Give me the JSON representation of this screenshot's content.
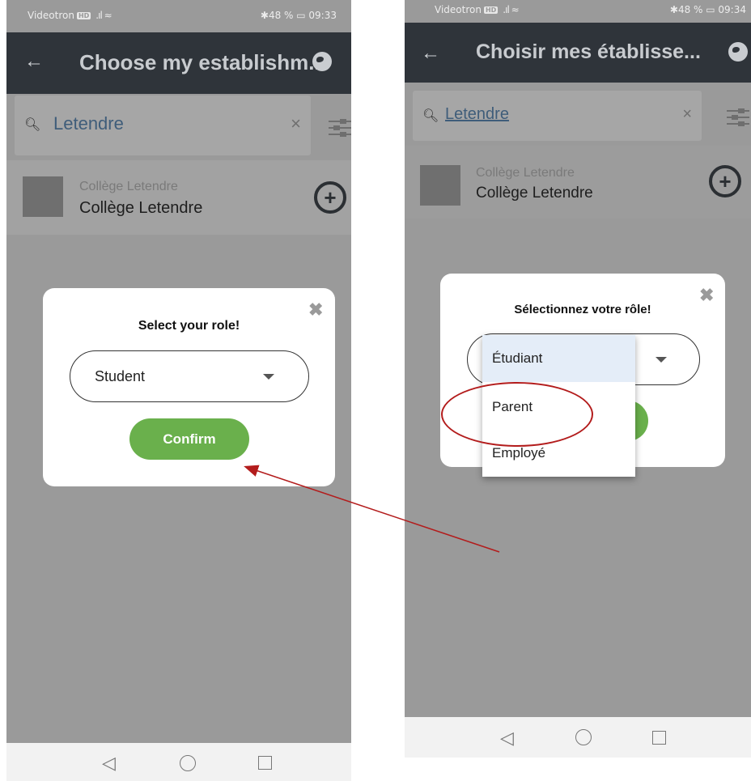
{
  "left": {
    "status": {
      "carrier": "Videotron",
      "hd": "HD",
      "right": "✱48 % ▭ 09:33"
    },
    "appbar": {
      "back": "←",
      "title": "Choose my establishm..."
    },
    "search": {
      "value": "Letendre",
      "clear": "×"
    },
    "result": {
      "subtitle": "Collège Letendre",
      "title": "Collège Letendre",
      "add": "+"
    },
    "dialog": {
      "close": "✖",
      "title": "Select your role!",
      "selected": "Student",
      "confirm": "Confirm"
    },
    "nav": {
      "back": "◁"
    }
  },
  "right": {
    "status": {
      "carrier": "Videotron",
      "hd": "HD",
      "right": "✱48 % ▭ 09:34"
    },
    "appbar": {
      "back": "←",
      "title": "Choisir mes établisse..."
    },
    "search": {
      "value": "Letendre",
      "clear": "×"
    },
    "result": {
      "subtitle": "Collège Letendre",
      "title": "Collège Letendre",
      "add": "+"
    },
    "dialog": {
      "close": "✖",
      "title": "Sélectionnez votre rôle!"
    },
    "dropdown": {
      "options": [
        "Étudiant",
        "Parent",
        "Employé"
      ],
      "selected_index": 0,
      "highlighted_index": 1
    },
    "nav": {
      "back": "◁"
    }
  },
  "annotation": {
    "arrow_color": "#b31c1c",
    "ellipse_color": "#b31c1c"
  },
  "colors": {
    "appbar": "#2f343a",
    "confirm": "#6ab04c",
    "overlay": "#9a9a9a"
  }
}
